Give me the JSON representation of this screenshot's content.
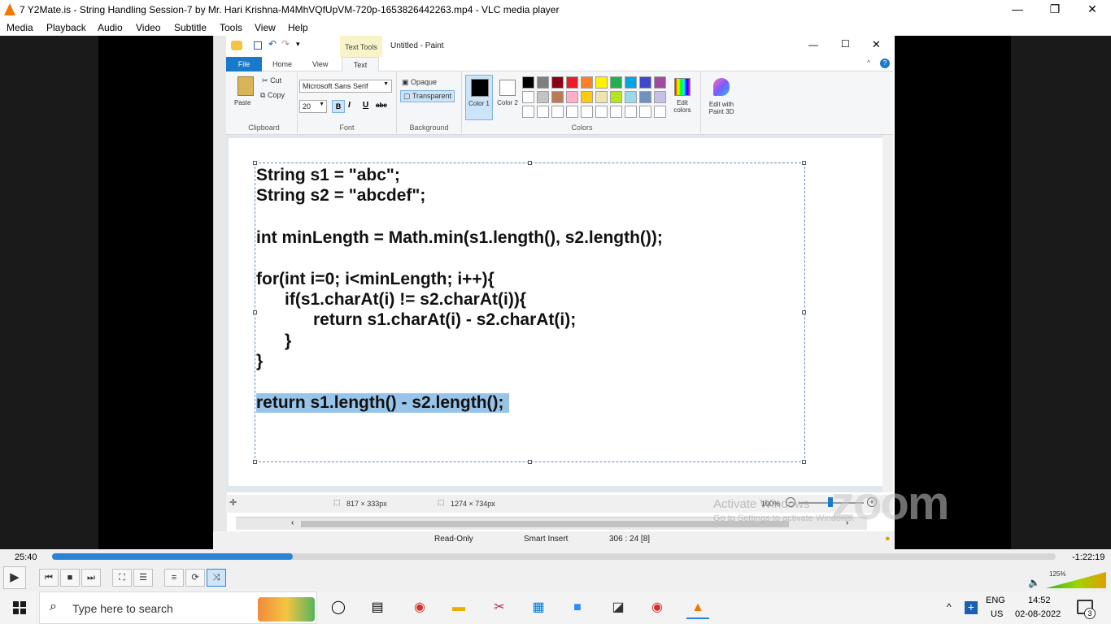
{
  "vlc": {
    "title": "7 Y2Mate.is - String Handling Session-7  by Mr. Hari Krishna-M4MhVQfUpVM-720p-1653826442263.mp4 - VLC media player",
    "menu": [
      "Media",
      "Playback",
      "Audio",
      "Video",
      "Subtitle",
      "Tools",
      "View",
      "Help"
    ],
    "time_elapsed": "25:40",
    "time_remaining": "-1:22:19",
    "progress": 0.24,
    "volume": "125%"
  },
  "paint": {
    "title": "Untitled - Paint",
    "context_tab": "Text Tools",
    "tabs": [
      "File",
      "Home",
      "View",
      "Text"
    ],
    "clipboard": {
      "paste": "Paste",
      "cut": "Cut",
      "copy": "Copy",
      "label": "Clipboard"
    },
    "font": {
      "family": "Microsoft Sans Serif",
      "size": "20",
      "label": "Font"
    },
    "background": {
      "opaque": "Opaque",
      "transparent": "Transparent",
      "label": "Background"
    },
    "colors": {
      "color1": "Color 1",
      "color2": "Color 2",
      "edit": "Edit colors",
      "label": "Colors",
      "row1": [
        "#000000",
        "#7f7f7f",
        "#880015",
        "#ed1c24",
        "#ff7f27",
        "#fff200",
        "#22b14c",
        "#00a2e8",
        "#3f48cc",
        "#a349a4"
      ],
      "row2": [
        "#ffffff",
        "#c3c3c3",
        "#b97a57",
        "#ffaec9",
        "#ffc90e",
        "#efe4b0",
        "#b5e61d",
        "#99d9ea",
        "#7092be",
        "#c8bfe7"
      ]
    },
    "paint3d": "Edit with Paint 3D",
    "code": [
      "String s1 = \"abc\";",
      "String s2 = \"abcdef\";",
      "int minLength = Math.min(s1.length(), s2.length());",
      "for(int i=0; i<minLength; i++){",
      "      if(s1.charAt(i) != s2.charAt(i)){",
      "            return s1.charAt(i) - s2.charAt(i);",
      "      }",
      "}",
      "return s1.length() - s2.length();"
    ],
    "status": {
      "selection": "817 × 333px",
      "canvas": "1274 × 734px",
      "zoom": "100%"
    }
  },
  "editor_status": {
    "mode": "Read-Only",
    "insert": "Smart Insert",
    "pos": "306 : 24 [8]"
  },
  "watermark": {
    "activate": "Activate Windows",
    "activate_sub": "Go to Settings to activate Windows.",
    "zoom": "zoom"
  },
  "taskbar": {
    "search": "Type here to search",
    "lang": "ENG",
    "region": "US",
    "time": "14:52",
    "date": "02-08-2022",
    "notif": "3"
  }
}
